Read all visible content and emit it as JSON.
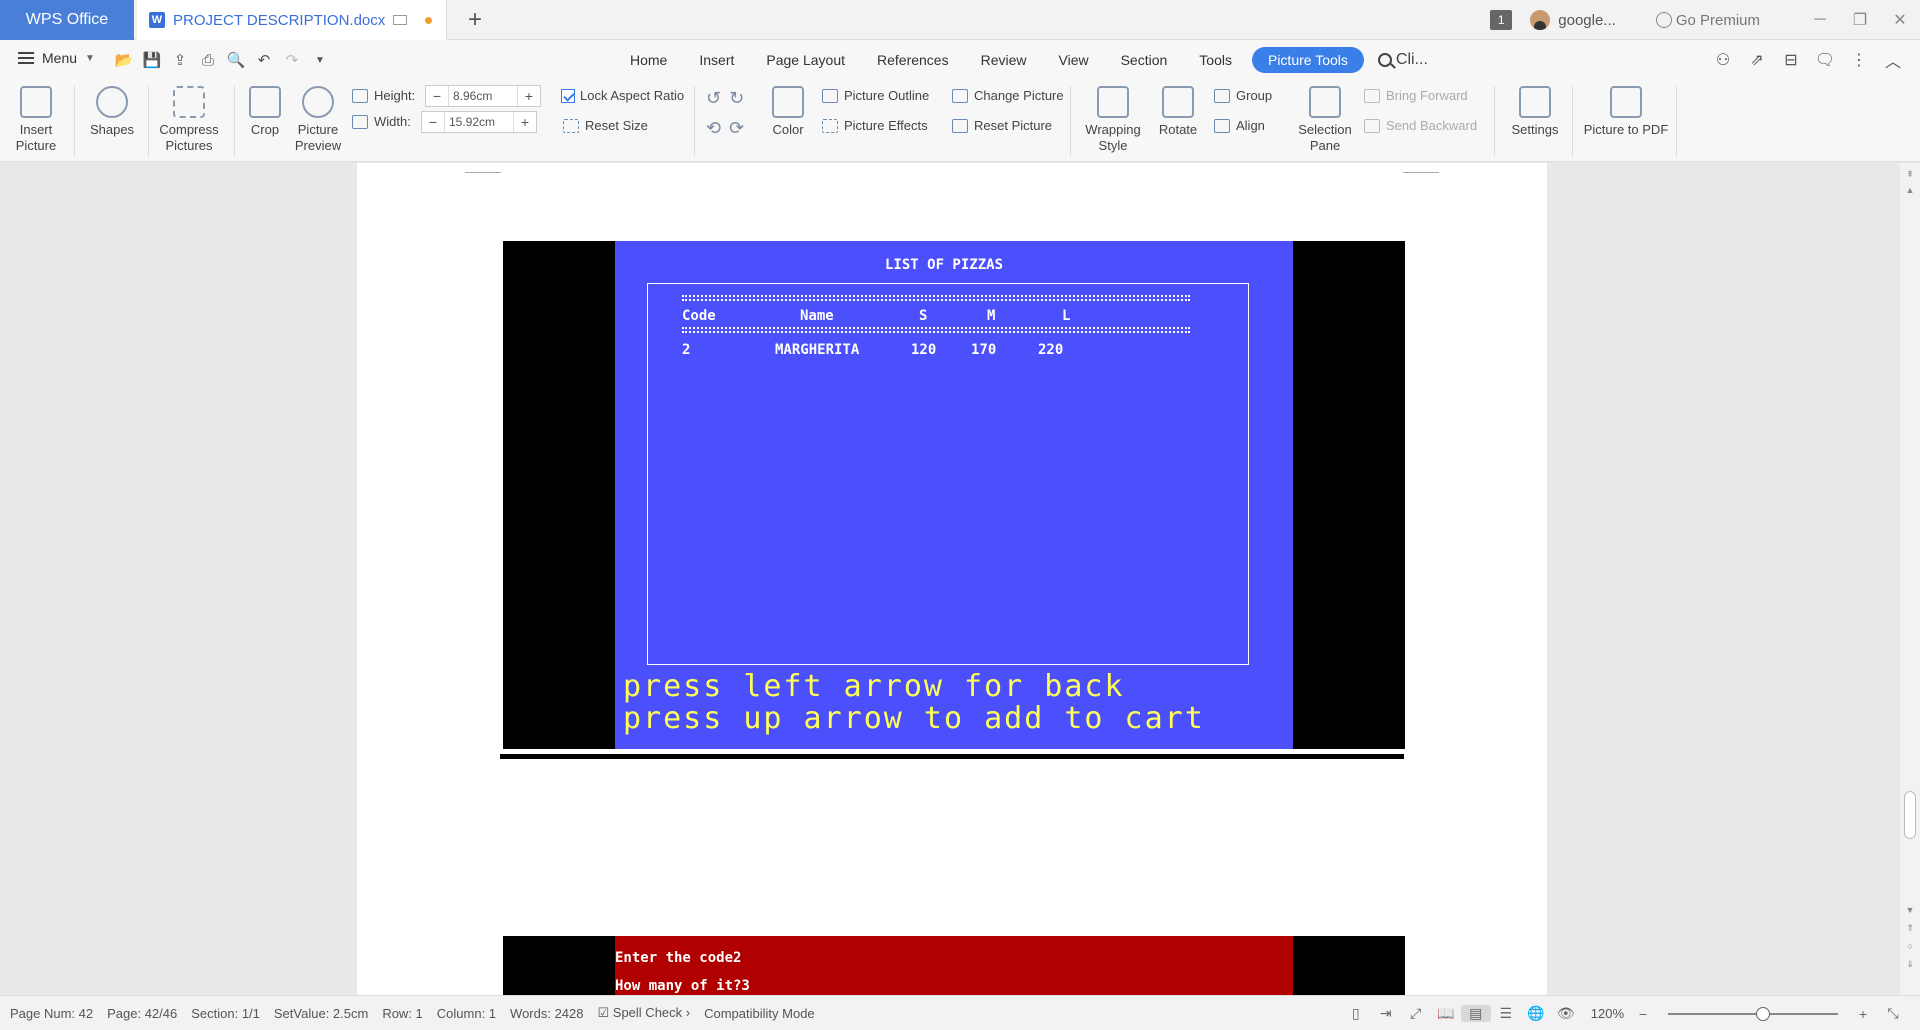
{
  "titlebar": {
    "app_tab": "WPS Office",
    "doc_tab": "PROJECT DESCRIPTION.docx",
    "badge": "1",
    "account": "google...",
    "premium": "Go Premium"
  },
  "menurow": {
    "menu_label": "Menu",
    "tabs": [
      "Home",
      "Insert",
      "Page Layout",
      "References",
      "Review",
      "View",
      "Section",
      "Tools"
    ],
    "active_tab": "Picture Tools",
    "search_text": "Cli..."
  },
  "ribbon": {
    "insert_picture": "Insert\nPicture",
    "shapes": "Shapes",
    "compress": "Compress\nPictures",
    "crop": "Crop",
    "preview": "Picture\nPreview",
    "height_label": "Height:",
    "height_value": "8.96cm",
    "width_label": "Width:",
    "width_value": "15.92cm",
    "lock_aspect": "Lock Aspect Ratio",
    "reset_size": "Reset Size",
    "color": "Color",
    "picture_outline": "Picture Outline",
    "picture_effects": "Picture Effects",
    "change_picture": "Change Picture",
    "reset_picture": "Reset Picture",
    "wrapping": "Wrapping\nStyle",
    "rotate": "Rotate",
    "group": "Group",
    "align": "Align",
    "selection_pane": "Selection\nPane",
    "bring_forward": "Bring Forward",
    "send_backward": "Send Backward",
    "settings": "Settings",
    "picture_to_pdf": "Picture to PDF"
  },
  "document": {
    "pic1": {
      "title": "LIST OF PIZZAS",
      "rule": "==========================================================",
      "headers": [
        "Code",
        "Name",
        "S",
        "M",
        "L"
      ],
      "row": [
        "2",
        "MARGHERITA",
        "120",
        "170",
        "220"
      ],
      "line1": "press left arrow for back",
      "line2": "press up arrow to add to cart"
    },
    "pic2": {
      "line1": "Enter the code2",
      "line2": "How many of it?3"
    }
  },
  "statusbar": {
    "page_num": "Page Num: 42",
    "page": "Page: 42/46",
    "section": "Section: 1/1",
    "setvalue": "SetValue: 2.5cm",
    "row": "Row: 1",
    "column": "Column: 1",
    "words": "Words: 2428",
    "spell": "Spell Check",
    "compat": "Compatibility Mode",
    "zoom": "120%"
  },
  "colors": {
    "accent": "#3a7fe8",
    "dos_blue": "#4b4ffc",
    "dos_yellow": "#ffff55",
    "dos_red": "#b00000"
  }
}
